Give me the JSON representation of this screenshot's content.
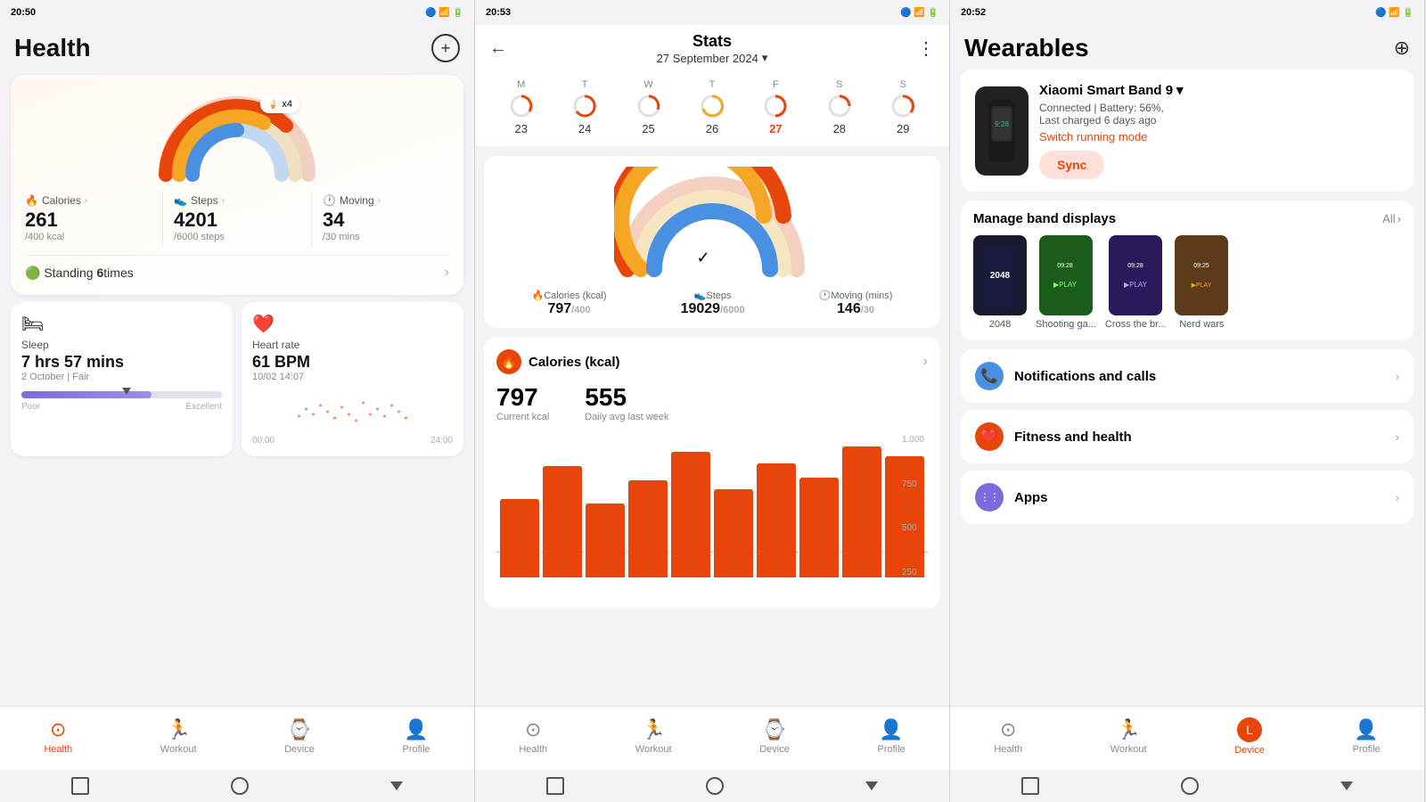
{
  "panel1": {
    "status_time": "20:50",
    "title": "Health",
    "activity": {
      "calories_label": "Calories",
      "steps_label": "Steps",
      "moving_label": "Moving",
      "calories_value": "261",
      "calories_goal": "/400 kcal",
      "steps_value": "4201",
      "steps_goal": "/6000 steps",
      "moving_value": "34",
      "moving_goal": "/30 mins",
      "standing_text": "Standing ",
      "standing_count": "6",
      "standing_suffix": "times",
      "treat_badge": "x4"
    },
    "sleep": {
      "label": "Sleep",
      "value": "7 hrs 57 mins",
      "sub": "2 October | Fair"
    },
    "heart": {
      "label": "Heart rate",
      "value": "61 BPM",
      "sub": "10/02 14:07"
    },
    "sleep_bar_labels": [
      "Poor",
      "Excellent"
    ],
    "nav": {
      "health": "Health",
      "workout": "Workout",
      "device": "Device",
      "profile": "Profile"
    }
  },
  "panel2": {
    "status_time": "20:53",
    "back": "←",
    "title": "Stats",
    "date": "27 September 2024",
    "days": [
      {
        "label": "M",
        "num": "23",
        "active": false
      },
      {
        "label": "T",
        "num": "24",
        "active": false
      },
      {
        "label": "W",
        "num": "25",
        "active": false
      },
      {
        "label": "T",
        "num": "26",
        "active": false
      },
      {
        "label": "F",
        "num": "27",
        "active": true
      },
      {
        "label": "S",
        "num": "28",
        "active": false
      },
      {
        "label": "S",
        "num": "29",
        "active": false
      }
    ],
    "calories_label": "Calories (kcal)",
    "steps_label": "Steps",
    "moving_label": "Moving (mins)",
    "calories_value": "797",
    "calories_goal": "400",
    "steps_value": "19029",
    "steps_goal": "6000",
    "moving_value": "146",
    "moving_goal": "30",
    "cal_card": {
      "title": "Calories (kcal)",
      "current": "797",
      "current_label": "Current kcal",
      "avg": "555",
      "avg_label": "Daily avg last week"
    },
    "chart_labels": [
      "1,000",
      "750",
      "500",
      "250"
    ],
    "bars": [
      60,
      80,
      55,
      70,
      90,
      65,
      85,
      75,
      95,
      88
    ]
  },
  "panel3": {
    "status_time": "20:52",
    "title": "Wearables",
    "device": {
      "name": "Xiaomi Smart Band 9",
      "status": "Connected | Battery: 56%,",
      "status2": "Last charged 6 days ago",
      "switch_label": "Switch running mode",
      "sync_label": "Sync"
    },
    "band_section": {
      "title": "Manage band displays",
      "all": "All",
      "items": [
        {
          "name": "2048",
          "color": "#1a1a2e"
        },
        {
          "name": "Shooting ga...",
          "color": "#1a5c1a"
        },
        {
          "name": "Cross the br...",
          "color": "#2a1a5c"
        },
        {
          "name": "Nerd wars",
          "color": "#5c3a1a"
        }
      ]
    },
    "menu_items": [
      {
        "label": "Notifications and calls",
        "icon": "📞",
        "icon_class": "blue"
      },
      {
        "label": "Fitness and health",
        "icon": "❤️",
        "icon_class": "red"
      },
      {
        "label": "Apps",
        "icon": "⋮⋮",
        "icon_class": "purple"
      }
    ],
    "nav": {
      "health": "Health",
      "workout": "Workout",
      "device": "Device",
      "profile": "Profile"
    }
  }
}
